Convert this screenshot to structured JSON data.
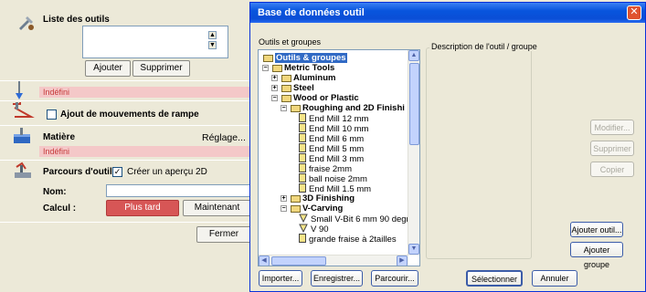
{
  "left": {
    "tool_list_label": "Liste des outils",
    "add_label": "Ajouter",
    "remove_label": "Supprimer",
    "undefined_1": "Indéfini",
    "ramp_label": "Ajout de mouvements de rampe",
    "material_label": "Matière",
    "settings_label": "Réglage...",
    "undefined_2": "Indéfini",
    "toolpaths_label": "Parcours d'outils",
    "preview_label": "Créer un aperçu 2D",
    "preview_checked": true,
    "name_label": "Nom:",
    "calc_label": "Calcul :",
    "later_label": "Plus tard",
    "now_label": "Maintenant",
    "close_label": "Fermer"
  },
  "dialog": {
    "title": "Base de données outil",
    "close_glyph": "✕",
    "tree_label": "Outils et groupes",
    "desc_label": "Description de l'outil / groupe",
    "tree": [
      {
        "text": "Outils & groupes",
        "bold": true,
        "selected": true,
        "kind": "folder"
      },
      {
        "text": "Metric Tools",
        "bold": true,
        "kind": "folder",
        "exp": "−"
      },
      {
        "text": "Aluminum",
        "bold": true,
        "kind": "folder",
        "exp": "+"
      },
      {
        "text": "Steel",
        "bold": true,
        "kind": "folder",
        "exp": "+"
      },
      {
        "text": "Wood or Plastic",
        "bold": true,
        "kind": "folder",
        "exp": "−"
      },
      {
        "text": "Roughing and 2D Finishi",
        "bold": true,
        "kind": "folder",
        "exp": "−"
      },
      {
        "text": "End Mill 12 mm",
        "kind": "tool"
      },
      {
        "text": "End Mill 10 mm",
        "kind": "tool"
      },
      {
        "text": "End Mill 6 mm",
        "kind": "tool"
      },
      {
        "text": "End Mill 5 mm",
        "kind": "tool"
      },
      {
        "text": "End Mill 3 mm",
        "kind": "tool"
      },
      {
        "text": "fraise 2mm",
        "kind": "tool"
      },
      {
        "text": "ball noise 2mm",
        "kind": "tool"
      },
      {
        "text": "End Mill 1.5 mm",
        "kind": "tool"
      },
      {
        "text": "3D Finishing",
        "bold": true,
        "kind": "folder",
        "exp": "+"
      },
      {
        "text": "V-Carving",
        "bold": true,
        "kind": "folder",
        "exp": "−"
      },
      {
        "text": "Small V-Bit 6 mm 90 degre",
        "kind": "vbit"
      },
      {
        "text": "V 90",
        "kind": "vbit"
      },
      {
        "text": "grande fraise à 2tailles",
        "kind": "tool"
      }
    ],
    "buttons": {
      "modify": "Modifier...",
      "delete": "Supprimer",
      "copy": "Copier",
      "add_tool": "Ajouter outil...",
      "add_group": "Ajouter groupe",
      "import": "Importer...",
      "save": "Enregistrer...",
      "browse": "Parcourir...",
      "select": "Sélectionner",
      "cancel": "Annuler"
    }
  },
  "colors": {
    "accent": "#0a4ed6",
    "warning_bg": "#f4c8c8",
    "warning_text": "#c63a3a",
    "later_button": "#d75656"
  }
}
